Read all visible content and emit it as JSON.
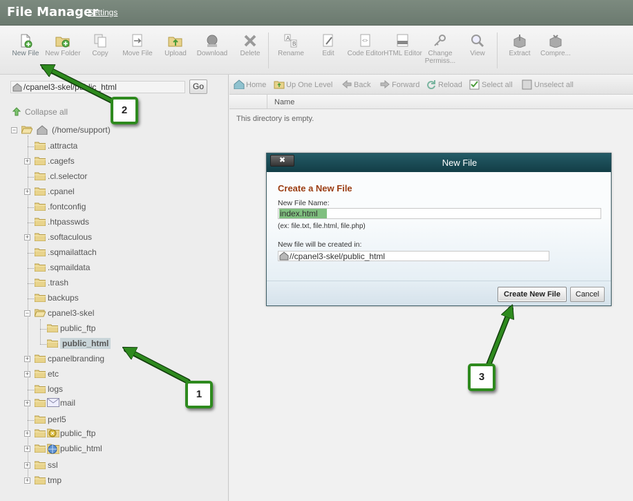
{
  "header": {
    "title": "File Manager",
    "settings_link": "Settings"
  },
  "toolbar": {
    "items": [
      {
        "label": "New File",
        "icon": "new-file-icon"
      },
      {
        "label": "New Folder",
        "icon": "new-folder-icon"
      },
      {
        "label": "Copy",
        "icon": "copy-icon"
      },
      {
        "label": "Move File",
        "icon": "move-file-icon"
      },
      {
        "label": "Upload",
        "icon": "upload-icon"
      },
      {
        "label": "Download",
        "icon": "download-icon"
      },
      {
        "label": "Delete",
        "icon": "delete-icon"
      },
      {
        "label": "Rename",
        "icon": "rename-icon"
      },
      {
        "label": "Edit",
        "icon": "edit-icon"
      },
      {
        "label": "Code Editor",
        "icon": "code-editor-icon"
      },
      {
        "label": "HTML Editor",
        "icon": "html-editor-icon"
      },
      {
        "label": "Change Permiss...",
        "icon": "change-permissions-icon"
      },
      {
        "label": "View",
        "icon": "view-icon"
      },
      {
        "label": "Extract",
        "icon": "extract-icon"
      },
      {
        "label": "Compre...",
        "icon": "compress-icon"
      }
    ]
  },
  "sidebar": {
    "path_value": "/cpanel3-skel/public_html",
    "go_label": "Go",
    "collapse_all": "Collapse all",
    "root_label": "(/home/support)",
    "items": [
      {
        "label": ".attracta"
      },
      {
        "label": ".cagefs"
      },
      {
        "label": ".cl.selector"
      },
      {
        "label": ".cpanel"
      },
      {
        "label": ".fontconfig"
      },
      {
        "label": ".htpasswds"
      },
      {
        "label": ".softaculous"
      },
      {
        "label": ".sqmailattach"
      },
      {
        "label": ".sqmaildata"
      },
      {
        "label": ".trash"
      },
      {
        "label": "backups"
      },
      {
        "label": "cpanel3-skel"
      },
      {
        "label": "public_ftp"
      },
      {
        "label": "public_html"
      },
      {
        "label": "cpanelbranding"
      },
      {
        "label": "etc"
      },
      {
        "label": "logs"
      },
      {
        "label": "mail"
      },
      {
        "label": "perl5"
      },
      {
        "label": "public_ftp"
      },
      {
        "label": "public_html"
      },
      {
        "label": "ssl"
      },
      {
        "label": "tmp"
      }
    ]
  },
  "navbar": {
    "items": [
      {
        "label": "Home"
      },
      {
        "label": "Up One Level"
      },
      {
        "label": "Back"
      },
      {
        "label": "Forward"
      },
      {
        "label": "Reload"
      },
      {
        "label": "Select all"
      },
      {
        "label": "Unselect all"
      }
    ]
  },
  "file_list": {
    "column_name": "Name",
    "empty_message": "This directory is empty."
  },
  "dialog": {
    "title": "New File",
    "close_label": "✖",
    "heading": "Create a New File",
    "name_label": "New File Name:",
    "name_value": "index.html",
    "name_hint": "(ex: file.txt, file.html, file.php)",
    "location_label": "New file will be created in:",
    "location_value": "//cpanel3-skel/public_html",
    "create_button": "Create New File",
    "cancel_button": "Cancel"
  },
  "annotations": {
    "step1": "1",
    "step2": "2",
    "step3": "3"
  },
  "colors": {
    "header_bg": "#74837a",
    "dialog_title_bg": "#1b4a54",
    "annotation_green": "#2e8a1e",
    "heading_red": "#9b3d12"
  }
}
